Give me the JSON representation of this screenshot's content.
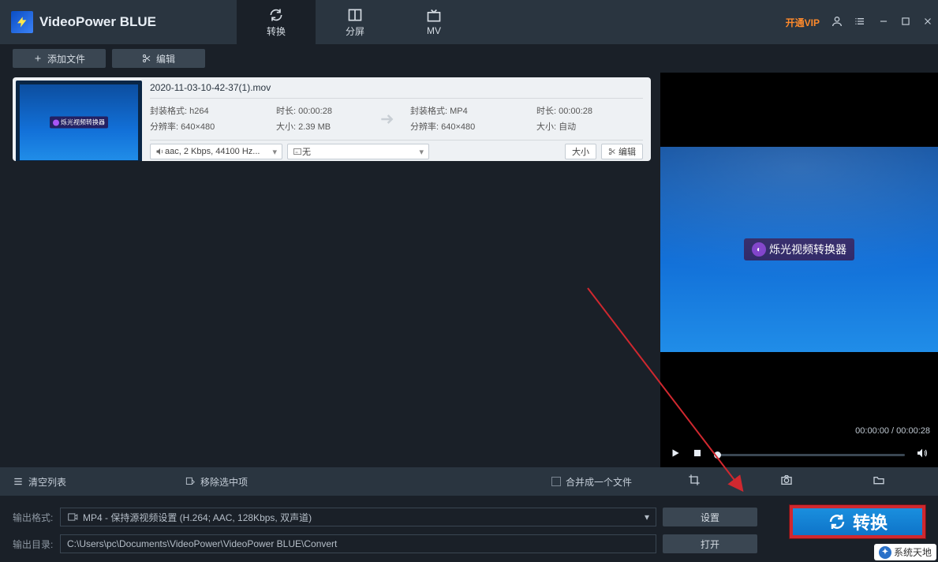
{
  "app": {
    "title": "VideoPower BLUE"
  },
  "tabs": {
    "convert": "转换",
    "split": "分屏",
    "mv": "MV"
  },
  "win": {
    "vip": "开通VIP"
  },
  "toolbar": {
    "add": "添加文件",
    "edit": "编辑"
  },
  "file": {
    "name": "2020-11-03-10-42-37(1).mov",
    "src": {
      "format_label": "封装格式:",
      "format": "h264",
      "res_label": "分辨率:",
      "res": "640×480",
      "dur_label": "时长:",
      "dur": "00:00:28",
      "size_label": "大小:",
      "size": "2.39 MB"
    },
    "dst": {
      "format_label": "封装格式:",
      "format": "MP4",
      "res_label": "分辨率:",
      "res": "640×480",
      "dur_label": "时长:",
      "dur": "00:00:28",
      "size_label": "大小:",
      "size": "自动"
    },
    "audio_sel": "aac, 2 Kbps, 44100 Hz...",
    "subtitle_sel": "无",
    "size_btn": "大小",
    "edit_btn": "编辑",
    "thumb_text": "烁光视频转换器"
  },
  "preview": {
    "badge": "烁光视频转换器",
    "time_cur": "00:00:00",
    "time_total": "00:00:28"
  },
  "actions": {
    "clear": "清空列表",
    "remove": "移除选中项",
    "merge": "合并成一个文件"
  },
  "output": {
    "format_label": "输出格式:",
    "format_value": "MP4 - 保持源视频设置 (H.264; AAC, 128Kbps, 双声道)",
    "settings_btn": "设置",
    "dir_label": "输出目录:",
    "dir_value": "C:\\Users\\pc\\Documents\\VideoPower\\VideoPower BLUE\\Convert",
    "open_btn": "打开",
    "convert_btn": "转换"
  },
  "watermark": "系统天地"
}
